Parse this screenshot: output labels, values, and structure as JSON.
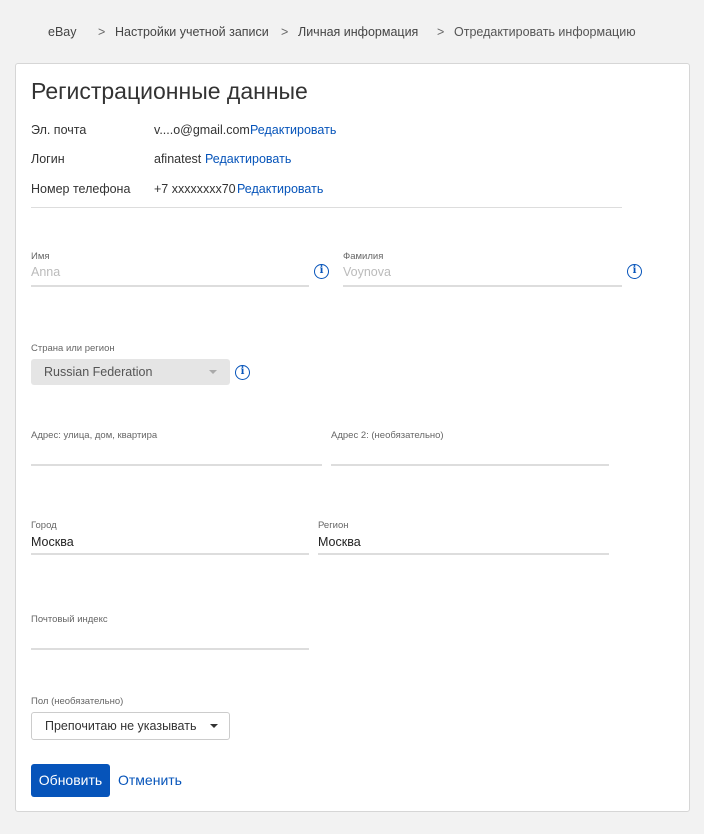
{
  "breadcrumb": {
    "items": [
      "eBay",
      "Настройки учетной записи",
      "Личная информация",
      "Отредактировать информацию"
    ],
    "separator": ">"
  },
  "form": {
    "title": "Регистрационные данные",
    "email": {
      "label": "Эл. почта",
      "value": "v....o@gmail.com",
      "edit": "Редактировать"
    },
    "login": {
      "label": "Логин",
      "value": "afinatest",
      "edit": "Редактировать"
    },
    "phone": {
      "label": "Номер телефона",
      "value": "+7 xxxxxxxx70",
      "edit": "Редактировать"
    },
    "first_name": {
      "label": "Имя",
      "placeholder": "Anna"
    },
    "last_name": {
      "label": "Фамилия",
      "placeholder": "Voynova"
    },
    "country": {
      "label": "Страна или регион",
      "value": "Russian Federation"
    },
    "address1": {
      "label": "Адрес: улица, дом, квартира",
      "value": ""
    },
    "address2": {
      "label": "Адрес 2: (необязательно)",
      "value": ""
    },
    "city": {
      "label": "Город",
      "value": "Москва"
    },
    "region": {
      "label": "Регион",
      "value": "Москва"
    },
    "postal": {
      "label": "Почтовый индекс",
      "value": ""
    },
    "gender": {
      "label": "Пол (необязательно)",
      "value": "Препочитаю не указывать"
    },
    "submit": "Обновить",
    "cancel": "Отменить"
  },
  "icons": {
    "info": "info-icon",
    "dropdown": "chevron-down-icon"
  },
  "colors": {
    "accent": "#0654ba",
    "background": "#f2f2f2",
    "card": "#ffffff"
  }
}
